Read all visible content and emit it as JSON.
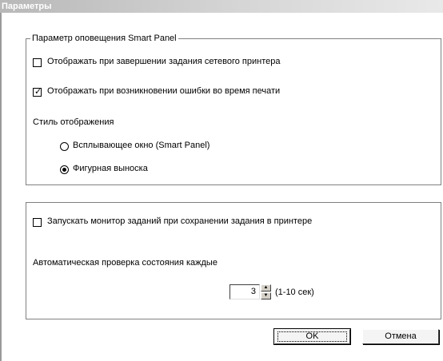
{
  "window": {
    "title": "Параметры"
  },
  "notification_group": {
    "legend": "Параметр оповещения Smart Panel",
    "option_network_printer": {
      "label": "Отображать при завершении задания сетевого принтера",
      "checked": false
    },
    "option_print_error": {
      "label": "Отображать при возникновении ошибки во время печати",
      "checked": true
    },
    "display_style": {
      "label": "Стиль отображения",
      "options": [
        {
          "label": "Всплывающее окно (Smart Panel)",
          "selected": false
        },
        {
          "label": "Фигурная выноска",
          "selected": true
        }
      ]
    }
  },
  "monitor_group": {
    "option_job_monitor": {
      "label": "Запускать монитор заданий при сохранении задания в принтере",
      "checked": false
    },
    "status_check_label": "Автоматическая проверка состояния каждые",
    "interval": {
      "value": "3",
      "range_label": "(1-10 сек)"
    }
  },
  "buttons": {
    "ok": "OK",
    "cancel": "Отмена"
  }
}
